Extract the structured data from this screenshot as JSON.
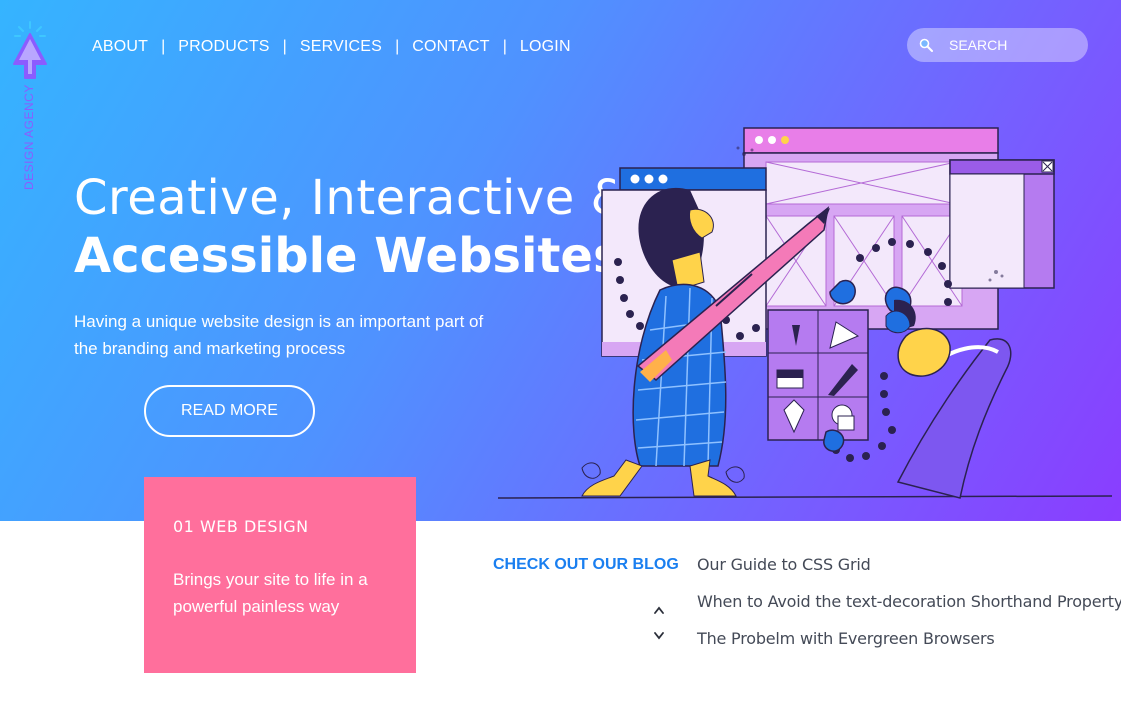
{
  "brand": {
    "vertical_text": "DESIGN AGENCY"
  },
  "nav": {
    "items": [
      "ABOUT",
      "PRODUCTS",
      "SERVICES",
      "CONTACT",
      "LOGIN"
    ],
    "separator": "|"
  },
  "search": {
    "placeholder": "SEARCH",
    "icon": "search-icon"
  },
  "hero": {
    "title_line1": "Creative, Interactive &",
    "title_line2": "Accessible Websites",
    "subtitle": "Having a unique website design is an important part of the branding and marketing process",
    "cta_label": "READ MORE"
  },
  "card": {
    "title": "01 WEB DESIGN",
    "text": "Brings your site to life in a powerful painless way"
  },
  "blog": {
    "heading": "CHECK OUT OUR BLOG",
    "up_icon": "chevron-up-icon",
    "down_icon": "chevron-down-icon",
    "posts": [
      "Our Guide to CSS Grid",
      "When to Avoid the text-decoration Shorthand Property",
      "The Probelm with Evergreen Browsers"
    ]
  },
  "colors": {
    "gradient_start": "#35b4ff",
    "gradient_end": "#8a3dff",
    "card_pink": "#ff6f9c",
    "blog_blue": "#1a7ff0",
    "logo_purple": "#8b5cff"
  }
}
